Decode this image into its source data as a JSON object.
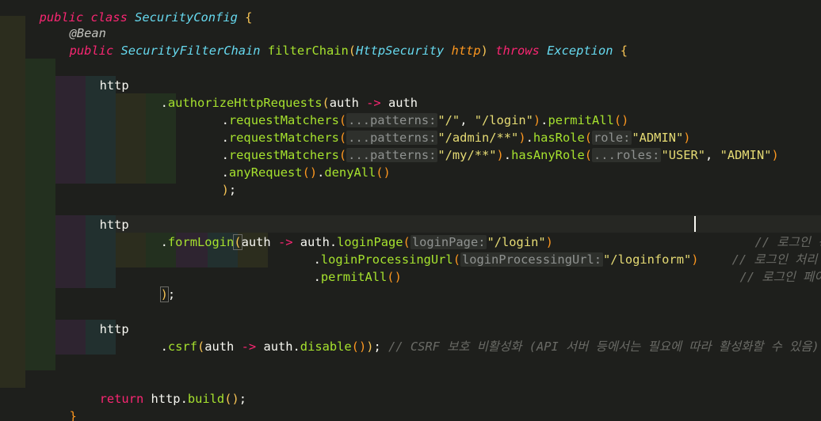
{
  "editor": {
    "class_decl": {
      "visibility": "public",
      "class_kw": "class",
      "class_name": "SecurityConfig",
      "brace": "{"
    },
    "annotation": "@Bean",
    "method_sig": {
      "public_kw": "public",
      "return_type": "SecurityFilterChain",
      "name": "filterChain",
      "open": "(",
      "param_type": "HttpSecurity",
      "param_name": "http",
      "close": ")",
      "throws_kw": "throws",
      "exception": "Exception",
      "brace": "{"
    },
    "block1": {
      "http": "http",
      "authorize": {
        "dot": ".",
        "method": "authorizeHttpRequests",
        "open": "(",
        "lambda_param": "auth",
        "arrow": "->",
        "lambda_body": "auth"
      },
      "matcher1": {
        "dot": ".",
        "method": "requestMatchers",
        "open": "(",
        "hint": "...patterns:",
        "arg1": "\"/\"",
        "comma": ",",
        "arg2": "\"/login\"",
        "close": ")",
        "dot2": ".",
        "chain": "permitAll",
        "chain_parens": "()"
      },
      "matcher2": {
        "dot": ".",
        "method": "requestMatchers",
        "open": "(",
        "hint": "...patterns:",
        "arg1": "\"/admin/**\"",
        "close": ")",
        "dot2": ".",
        "chain": "hasRole",
        "open2": "(",
        "hint2": "role:",
        "arg2": "\"ADMIN\"",
        "close2": ")"
      },
      "matcher3": {
        "dot": ".",
        "method": "requestMatchers",
        "open": "(",
        "hint": "...patterns:",
        "arg1": "\"/my/**\"",
        "close": ")",
        "dot2": ".",
        "chain": "hasAnyRole",
        "open2": "(",
        "hint2": "...roles:",
        "arg2": "\"USER\"",
        "comma": ",",
        "arg3": "\"ADMIN\"",
        "close2": ")"
      },
      "any_request": {
        "dot": ".",
        "method": "anyRequest",
        "parens": "()",
        "dot2": ".",
        "chain": "denyAll",
        "parens2": "()"
      },
      "end": {
        "close": ")",
        "semi": ";"
      }
    },
    "block2": {
      "http": "http",
      "form_login": {
        "dot": ".",
        "method": "formLogin",
        "open": "(",
        "lambda_param": "auth",
        "arrow": "->",
        "obj": "auth",
        "dot2": ".",
        "chain": "loginPage",
        "open2": "(",
        "hint": "loginPage:",
        "arg": "\"/login\"",
        "close2": ")",
        "comment": "// 로그인 경로설정"
      },
      "processing": {
        "dot": ".",
        "method": "loginProcessingUrl",
        "open": "(",
        "hint": "loginProcessingUrl:",
        "arg": "\"/loginform\"",
        "close": ")",
        "comment": "// 로그인 처리 URL 설"
      },
      "permit": {
        "dot": ".",
        "method": "permitAll",
        "parens": "()",
        "comment": "// 로그인 페이지는 누"
      },
      "end": {
        "close": ")",
        "semi": ";"
      }
    },
    "block3": {
      "http": "http",
      "csrf": {
        "dot": ".",
        "method": "csrf",
        "open": "(",
        "lambda_param": "auth",
        "arrow": "->",
        "obj": "auth",
        "dot2": ".",
        "chain": "disable",
        "parens": "()",
        "close": ")",
        "semi": ";",
        "comment": "// CSRF 보호 비활성화 (API 서버 등에서는 필요에 따라 활성화할 수 있음)"
      }
    },
    "return_stmt": {
      "kw": "return",
      "obj": "http",
      "dot": ".",
      "method": "build",
      "parens": "()",
      "semi": ";"
    },
    "closing_brace": "}"
  }
}
